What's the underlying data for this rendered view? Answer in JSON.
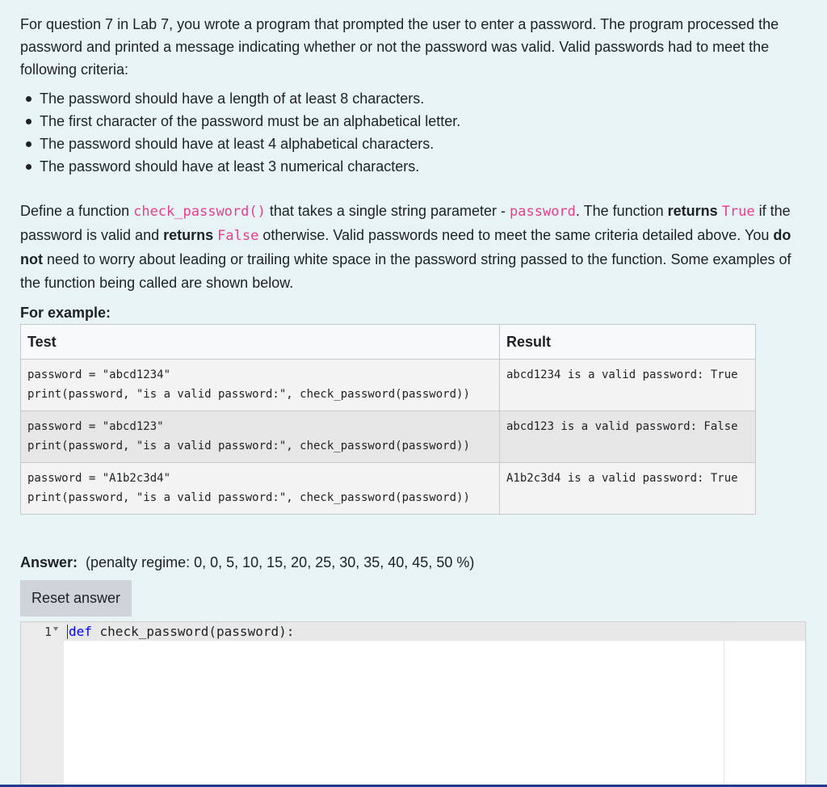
{
  "question": {
    "intro": "For question 7 in Lab 7, you wrote a program that prompted the user to enter a password. The program processed the password and printed a message indicating whether or not the password was valid. Valid passwords had to meet the following criteria:",
    "criteria": [
      "The password should have a length of at least 8 characters.",
      "The first character of the password must be an alphabetical letter.",
      "The password should have at least 4 alphabetical characters.",
      "The password should have at least 3 numerical characters."
    ],
    "define": {
      "t1": "Define a function ",
      "fn": "check_password()",
      "t2": " that takes a single string parameter - ",
      "param": "password",
      "t3": ". The function ",
      "returns1": "returns",
      "true_val": "True",
      "t4": " if the password is valid and ",
      "returns2": "returns",
      "false_val": "False",
      "t5": " otherwise. Valid passwords need to meet the same criteria detailed above. You ",
      "do_not": "do not",
      "t6": " need to worry about leading or trailing white space in the password string passed to the function. Some examples of the function being called are shown below."
    },
    "for_example": "For example:"
  },
  "examples_table": {
    "headers": [
      "Test",
      "Result"
    ],
    "rows": [
      {
        "test": "password = \"abcd1234\"\nprint(password, \"is a valid password:\", check_password(password))",
        "result": "abcd1234 is a valid password: True"
      },
      {
        "test": "password = \"abcd123\"\nprint(password, \"is a valid password:\", check_password(password))",
        "result": "abcd123 is a valid password: False"
      },
      {
        "test": "password = \"A1b2c3d4\"\nprint(password, \"is a valid password:\", check_password(password))",
        "result": "A1b2c3d4 is a valid password: True"
      }
    ]
  },
  "answer": {
    "label": "Answer:",
    "penalty": "(penalty regime: 0, 0, 5, 10, 15, 20, 25, 30, 35, 40, 45, 50 %)",
    "reset_label": "Reset answer"
  },
  "editor": {
    "line_number": "1",
    "keyword": "def",
    "code_rest": " check_password(password):"
  },
  "colors": {
    "background": "#e7f3f5",
    "inline_code": "#e83e8c",
    "keyword": "#0000ff",
    "button": "#ced4da"
  }
}
